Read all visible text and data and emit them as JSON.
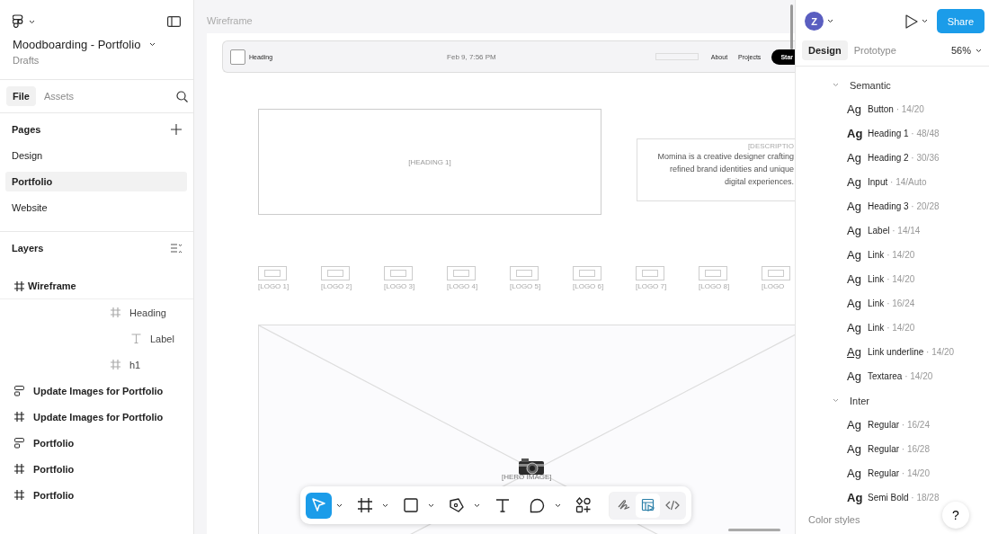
{
  "file": {
    "title": "Moodboarding - Portfolio",
    "location": "Drafts"
  },
  "left_tabs": [
    {
      "label": "File",
      "selected": true
    },
    {
      "label": "Assets",
      "selected": false
    }
  ],
  "pages": {
    "title": "Pages",
    "items": [
      {
        "label": "Design",
        "selected": false
      },
      {
        "label": "Portfolio",
        "selected": true
      },
      {
        "label": "Website",
        "selected": false
      }
    ]
  },
  "layers": {
    "title": "Layers",
    "items": [
      {
        "label": "Wireframe",
        "kind": "frame",
        "children": [
          {
            "label": "Heading",
            "kind": "frame",
            "children": [
              {
                "label": "Label",
                "kind": "text"
              }
            ]
          },
          {
            "label": "h1",
            "kind": "frame"
          }
        ]
      },
      {
        "label": "Update Images for Portfolio",
        "kind": "stack"
      },
      {
        "label": "Update Images for Portfolio",
        "kind": "frame"
      },
      {
        "label": "Portfolio",
        "kind": "stack"
      },
      {
        "label": "Portfolio",
        "kind": "frame"
      },
      {
        "label": "Portfolio",
        "kind": "frame"
      }
    ]
  },
  "canvas": {
    "frame_label": "Wireframe",
    "nav": {
      "heading": "Heading",
      "date": "Feb 9, 7:56 PM",
      "links": [
        "About",
        "Projects"
      ],
      "button": "Star"
    },
    "heading_placeholder": "[HEADING 1]",
    "description": {
      "label": "[DESCRIPTIO",
      "text": "Momina is a creative designer crafting refined brand identities and unique digital experiences."
    },
    "logos": [
      "[LOGO 1]",
      "[LOGO 2]",
      "[LOGO 3]",
      "[LOGO 4]",
      "[LOGO 5]",
      "[LOGO 6]",
      "[LOGO 7]",
      "[LOGO 8]",
      "[LOGO"
    ],
    "hero_label": "[HERO IMAGE]"
  },
  "toolbar": {
    "tools": [
      {
        "kind": "move",
        "selected": true,
        "caret": true
      },
      {
        "kind": "frame",
        "selected": false,
        "caret": true
      },
      {
        "kind": "rectangle",
        "selected": false,
        "caret": true
      },
      {
        "kind": "pen",
        "selected": false,
        "caret": true
      },
      {
        "kind": "text",
        "selected": false,
        "caret": false
      },
      {
        "kind": "comment",
        "selected": false,
        "caret": true
      },
      {
        "kind": "components",
        "selected": false,
        "caret": false
      }
    ],
    "modes": [
      {
        "kind": "draw",
        "selected": false
      },
      {
        "kind": "design",
        "selected": true
      },
      {
        "kind": "code",
        "selected": false
      }
    ]
  },
  "right": {
    "avatar": "Z",
    "share": "Share",
    "tabs": [
      {
        "label": "Design",
        "selected": true
      },
      {
        "label": "Prototype",
        "selected": false
      }
    ],
    "zoom": "56%",
    "groups": [
      {
        "title": "Semantic",
        "expanded": true,
        "styles": [
          {
            "sample": "Ag",
            "name": "Button",
            "spec": " · 14/20",
            "kind": "regular"
          },
          {
            "sample": "Ag",
            "name": "Heading 1",
            "spec": " · 48/48",
            "kind": "bold"
          },
          {
            "sample": "Ag",
            "name": "Heading 2",
            "spec": " · 30/36",
            "kind": "regular"
          },
          {
            "sample": "Ag",
            "name": "Input",
            "spec": " · 14/Auto",
            "kind": "regular"
          },
          {
            "sample": "Ag",
            "name": "Heading 3",
            "spec": " · 20/28",
            "kind": "regular"
          },
          {
            "sample": "Ag",
            "name": "Label",
            "spec": " · 14/14",
            "kind": "regular"
          },
          {
            "sample": "Ag",
            "name": "Link",
            "spec": " · 14/20",
            "kind": "regular"
          },
          {
            "sample": "Ag",
            "name": "Link",
            "spec": " · 14/20",
            "kind": "regular"
          },
          {
            "sample": "Ag",
            "name": "Link",
            "spec": " · 16/24",
            "kind": "regular"
          },
          {
            "sample": "Ag",
            "name": "Link",
            "spec": " · 14/20",
            "kind": "regular"
          },
          {
            "sample": "Ag",
            "name": "Link underline",
            "spec": " · 14/20",
            "kind": "underline"
          },
          {
            "sample": "Ag",
            "name": "Textarea",
            "spec": " · 14/20",
            "kind": "regular"
          }
        ]
      },
      {
        "title": "Inter",
        "expanded": true,
        "styles": [
          {
            "sample": "Ag",
            "name": "Regular",
            "spec": " · 16/24",
            "kind": "regular"
          },
          {
            "sample": "Ag",
            "name": "Regular",
            "spec": " · 16/28",
            "kind": "regular"
          },
          {
            "sample": "Ag",
            "name": "Regular",
            "spec": " · 14/20",
            "kind": "regular"
          },
          {
            "sample": "Ag",
            "name": "Semi Bold",
            "spec": " · 18/28",
            "kind": "bold"
          }
        ]
      }
    ],
    "next_section": "Color styles",
    "help": "?"
  }
}
